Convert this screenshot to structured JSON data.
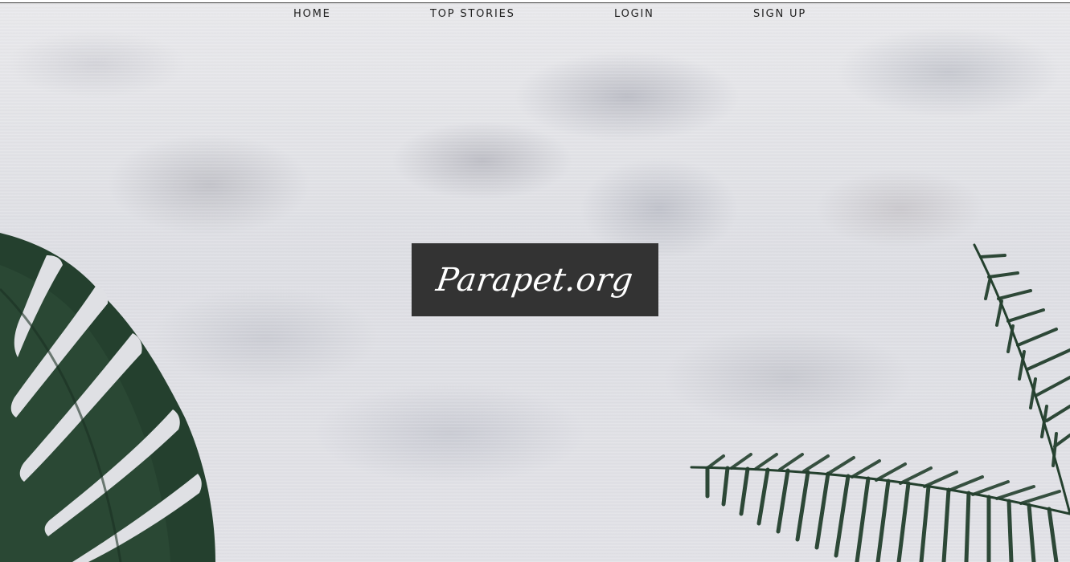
{
  "nav": {
    "home": "HOME",
    "top_stories": "TOP STORIES",
    "login": "LOGIN",
    "sign_up": "SIGN UP"
  },
  "hero": {
    "logo_text": "Parapet.org"
  },
  "colors": {
    "logo_bg": "#333333",
    "logo_text": "#ffffff",
    "nav_text": "#1f1f1f",
    "leaf_dark": "#233a2c",
    "leaf_mid": "#2f4a38"
  }
}
